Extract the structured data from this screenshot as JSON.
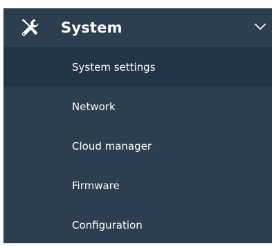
{
  "menu": {
    "section": {
      "title": "System",
      "icon": "wrench-screwdriver-icon",
      "expanded": true,
      "chevron_icon": "chevron-down-icon"
    },
    "items": [
      {
        "label": "System settings",
        "active": true
      },
      {
        "label": "Network",
        "active": false
      },
      {
        "label": "Cloud manager",
        "active": false
      },
      {
        "label": "Firmware",
        "active": false
      },
      {
        "label": "Configuration",
        "active": false
      }
    ]
  },
  "colors": {
    "sidebar_bg": "#2c3e50",
    "active_item_bg": "#243447",
    "text": "#ffffff"
  }
}
